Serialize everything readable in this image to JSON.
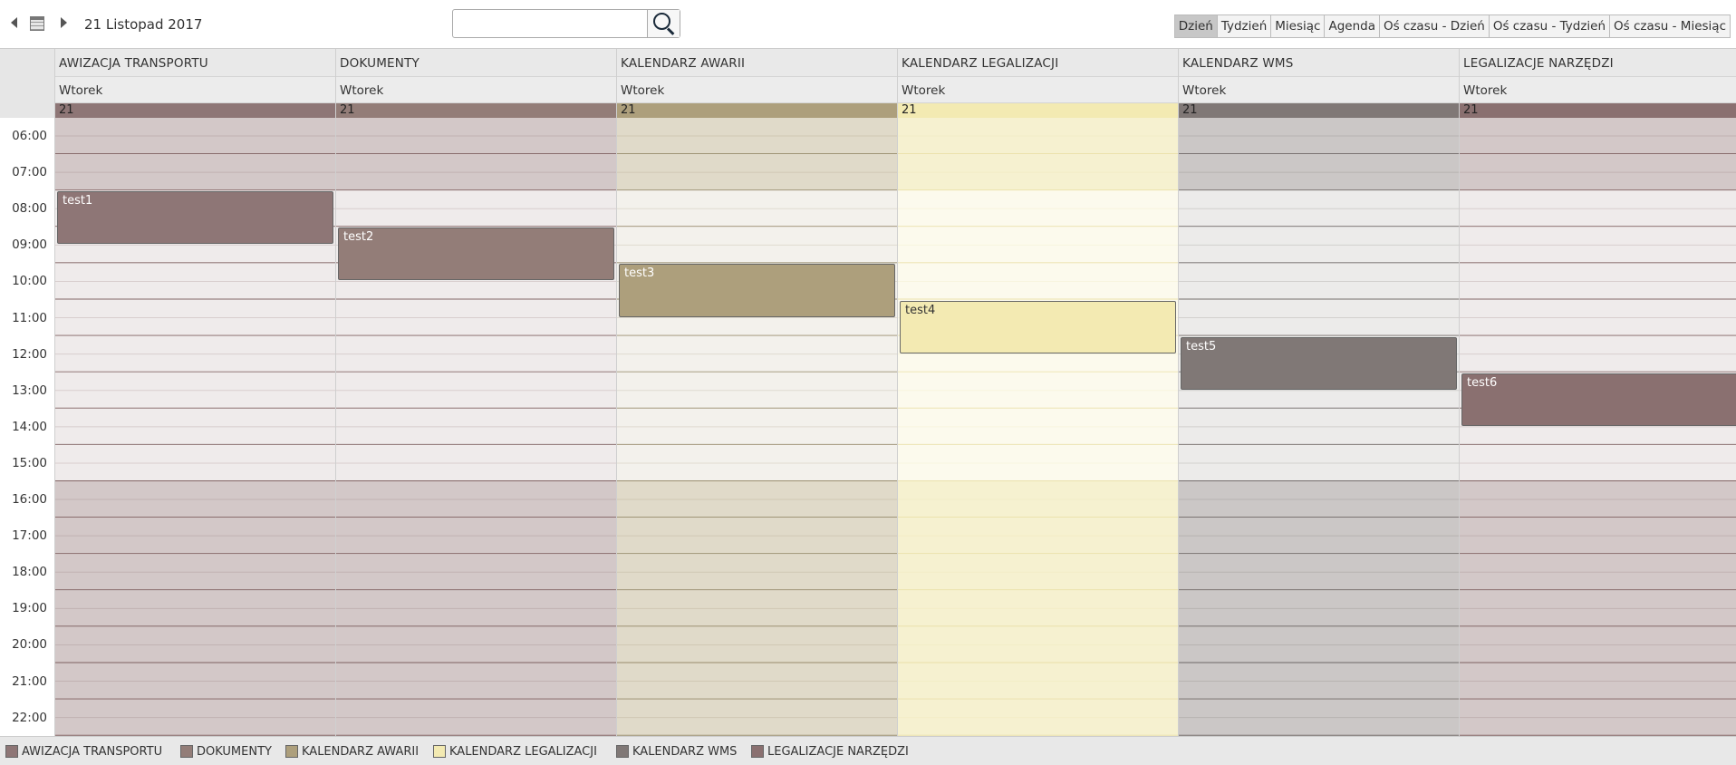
{
  "toolbar": {
    "date_label": "21 Listopad 2017",
    "search_value": "",
    "views": [
      "Dzień",
      "Tydzień",
      "Miesiąc",
      "Agenda",
      "Oś czasu - Dzień",
      "Oś czasu - Tydzień",
      "Oś czasu - Miesiąc"
    ],
    "active_view": "Dzień"
  },
  "times": [
    "06:00",
    "07:00",
    "08:00",
    "09:00",
    "10:00",
    "11:00",
    "12:00",
    "13:00",
    "14:00",
    "15:00",
    "16:00",
    "17:00",
    "18:00",
    "19:00",
    "20:00",
    "21:00",
    "22:00"
  ],
  "working_hours": {
    "start": "08:00",
    "end": "16:00"
  },
  "calendars": [
    {
      "name": "AWIZACJA TRANSPORTU",
      "day": "Wtorek",
      "date": "21",
      "color": "#8e7676",
      "offhours_bg": "#d3c8c8",
      "workhours_bg": "#efebeb",
      "line": "#6f4c4c",
      "event": {
        "title": "test1",
        "start": "08:00",
        "end": "09:30"
      }
    },
    {
      "name": "DOKUMENTY",
      "day": "Wtorek",
      "date": "21",
      "color": "#937d78",
      "offhours_bg": "#d3c8c8",
      "workhours_bg": "#efebeb",
      "line": "#6f4c4c",
      "event": {
        "title": "test2",
        "start": "09:00",
        "end": "10:30"
      }
    },
    {
      "name": "KALENDARZ AWARII",
      "day": "Wtorek",
      "date": "21",
      "color": "#ad9f7c",
      "offhours_bg": "#e0dac9",
      "workhours_bg": "#f3f1ec",
      "line": "#8a7c5a",
      "event": {
        "title": "test3",
        "start": "10:00",
        "end": "11:30"
      }
    },
    {
      "name": "KALENDARZ LEGALIZACJI",
      "day": "Wtorek",
      "date": "21",
      "color": "#f3eab2",
      "offhours_bg": "#f6f1d0",
      "workhours_bg": "#fcfaed",
      "line": "#e8dca0",
      "event": {
        "title": "test4",
        "start": "11:00",
        "end": "12:30"
      }
    },
    {
      "name": "KALENDARZ WMS",
      "day": "Wtorek",
      "date": "21",
      "color": "#807876",
      "offhours_bg": "#cbc7c6",
      "workhours_bg": "#ecebea",
      "line": "#5e5654",
      "event": {
        "title": "test5",
        "start": "12:00",
        "end": "13:30"
      }
    },
    {
      "name": "LEGALIZACJE NARZĘDZI",
      "day": "Wtorek",
      "date": "21",
      "color": "#8a7070",
      "offhours_bg": "#d3c8c8",
      "workhours_bg": "#efebeb",
      "line": "#6f4c4c",
      "event": {
        "title": "test6",
        "start": "13:00",
        "end": "14:30"
      }
    }
  ],
  "legend": [
    {
      "label": "AWIZACJA TRANSPORTU",
      "color": "#8e7676"
    },
    {
      "label": "DOKUMENTY",
      "color": "#937d78"
    },
    {
      "label": "KALENDARZ AWARII",
      "color": "#ad9f7c"
    },
    {
      "label": "KALENDARZ LEGALIZACJI",
      "color": "#f3eab2"
    },
    {
      "label": "KALENDARZ WMS",
      "color": "#807876"
    },
    {
      "label": "LEGALIZACJE NARZĘDZI",
      "color": "#8a7070"
    }
  ]
}
